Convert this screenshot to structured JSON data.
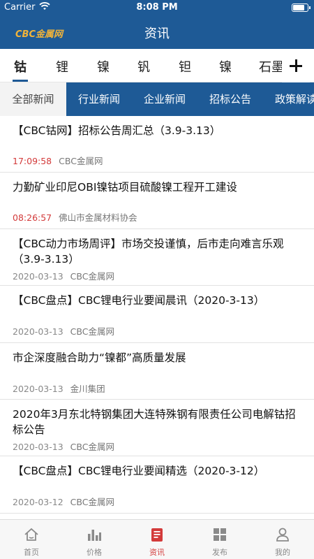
{
  "status_bar": {
    "carrier": "Carrier",
    "time": "8:08 PM",
    "battery_level": 0.8
  },
  "nav": {
    "logo": "CBC金属网",
    "title": "资讯"
  },
  "categories": [
    "钴",
    "锂",
    "镍",
    "钒",
    "钽",
    "镍",
    "石墨"
  ],
  "active_category_index": 0,
  "subtabs": [
    "全部新闻",
    "行业新闻",
    "企业新闻",
    "招标公告",
    "政策解读"
  ],
  "active_subtab_index": 0,
  "news": [
    {
      "title": "【CBC钴网】招标公告周汇总（3.9-3.13）",
      "time": "17:09:58",
      "time_highlight": true,
      "source": "CBC金属网"
    },
    {
      "title": "力勤矿业印尼OBI镍钴项目硫酸镍工程开工建设",
      "time": "08:26:57",
      "time_highlight": true,
      "source": "佛山市金属材料协会"
    },
    {
      "title": "【CBC动力市场周评】市场交投谨慎，后市走向难言乐观（3.9-3.13）",
      "time": "2020-03-13",
      "time_highlight": false,
      "source": "CBC金属网"
    },
    {
      "title": "【CBC盘点】CBC锂电行业要闻晨讯（2020-3-13）",
      "time": "2020-03-13",
      "time_highlight": false,
      "source": "CBC金属网"
    },
    {
      "title": "市企深度融合助力“镍都”高质量发展",
      "time": "2020-03-13",
      "time_highlight": false,
      "source": "金川集团"
    },
    {
      "title": "2020年3月东北特钢集团大连特殊钢有限责任公司电解钴招标公告",
      "time": "2020-03-13",
      "time_highlight": false,
      "source": "CBC金属网"
    },
    {
      "title": "【CBC盘点】CBC锂电行业要闻精选（2020-3-12）",
      "time": "2020-03-12",
      "time_highlight": false,
      "source": "CBC金属网"
    }
  ],
  "tabbar": [
    {
      "label": "首页",
      "icon": "home-icon"
    },
    {
      "label": "价格",
      "icon": "bar-chart-icon"
    },
    {
      "label": "资讯",
      "icon": "news-icon"
    },
    {
      "label": "发布",
      "icon": "grid-icon"
    },
    {
      "label": "我的",
      "icon": "person-icon"
    }
  ],
  "active_tab_index": 2,
  "colors": {
    "primary": "#1e5a96",
    "accent": "#d33a3a",
    "logo": "#f0b33a"
  }
}
